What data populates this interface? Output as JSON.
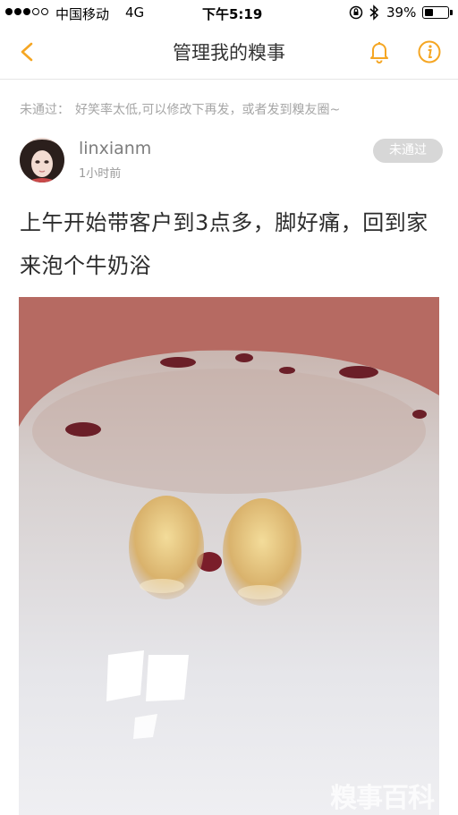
{
  "status_bar": {
    "carrier": "中国移动",
    "network": "4G",
    "time": "下午5:19",
    "battery": "39%"
  },
  "nav": {
    "title": "管理我的糗事",
    "accent_color": "#f5a623"
  },
  "notice": {
    "label": "未通过：",
    "message": "好笑率太低,可以修改下再发，或者发到糗友圈~"
  },
  "post": {
    "username": "linxianm",
    "time": "1小时前",
    "status": "未通过",
    "text": "上午开始带客户到3点多，脚好痛，回到家来泡个牛奶浴",
    "watermark": "糗事百科"
  }
}
